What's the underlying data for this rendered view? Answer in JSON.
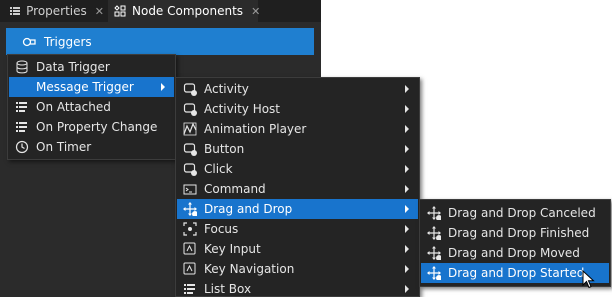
{
  "tabs": [
    {
      "label": "Properties",
      "close": "✕",
      "icon": "properties-list-icon",
      "active": false
    },
    {
      "label": "Node Components",
      "close": "✕",
      "icon": "node-components-icon",
      "active": true
    }
  ],
  "triggers_button": {
    "label": "Triggers",
    "icon": "triggers-icon"
  },
  "menu_main": {
    "items": [
      {
        "label": "Data Trigger",
        "icon": "data-trigger-icon",
        "submenu": false
      },
      {
        "label": "Message Trigger",
        "icon": "",
        "submenu": true,
        "highlighted": true
      },
      {
        "label": "On Attached",
        "icon": "on-attached-icon",
        "submenu": false
      },
      {
        "label": "On Property Change",
        "icon": "on-property-change-icon",
        "submenu": false
      },
      {
        "label": "On Timer",
        "icon": "on-timer-icon",
        "submenu": false
      }
    ]
  },
  "menu_message": {
    "items": [
      {
        "label": "Activity",
        "icon": "activity-icon"
      },
      {
        "label": "Activity Host",
        "icon": "activity-host-icon"
      },
      {
        "label": "Animation Player",
        "icon": "animation-player-icon"
      },
      {
        "label": "Button",
        "icon": "button-icon"
      },
      {
        "label": "Click",
        "icon": "click-icon"
      },
      {
        "label": "Command",
        "icon": "command-icon"
      },
      {
        "label": "Drag and Drop",
        "icon": "drag-and-drop-icon",
        "highlighted": true
      },
      {
        "label": "Focus",
        "icon": "focus-icon"
      },
      {
        "label": "Key Input",
        "icon": "key-input-icon"
      },
      {
        "label": "Key Navigation",
        "icon": "key-navigation-icon"
      },
      {
        "label": "List Box",
        "icon": "list-box-icon"
      }
    ]
  },
  "menu_dnd": {
    "items": [
      {
        "label": "Drag and Drop Canceled",
        "icon": "drag-and-drop-canceled-icon"
      },
      {
        "label": "Drag and Drop Finished",
        "icon": "drag-and-drop-finished-icon"
      },
      {
        "label": "Drag and Drop Moved",
        "icon": "drag-and-drop-moved-icon"
      },
      {
        "label": "Drag and Drop Started",
        "icon": "drag-and-drop-started-icon",
        "highlighted": true
      }
    ]
  },
  "colors": {
    "panel": "#2b2b2b",
    "tabbar": "#1f1f1f",
    "accent": "#1f7fd0",
    "menu_bg": "#242424",
    "highlight": "#1874cd"
  }
}
